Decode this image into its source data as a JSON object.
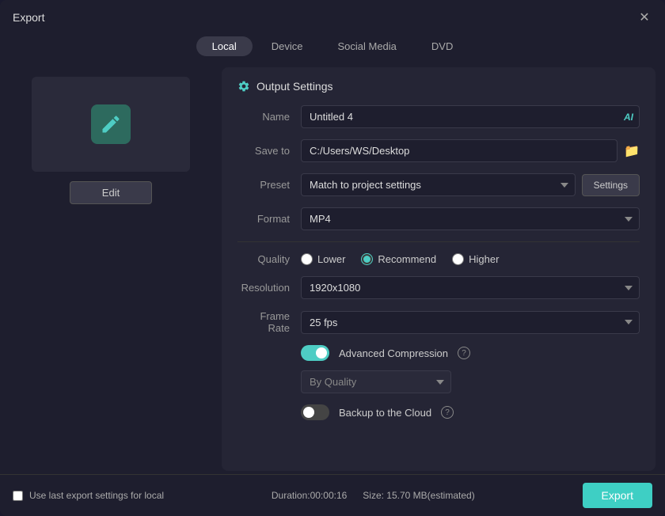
{
  "dialog": {
    "title": "Export"
  },
  "tabs": [
    {
      "id": "local",
      "label": "Local",
      "active": true
    },
    {
      "id": "device",
      "label": "Device",
      "active": false
    },
    {
      "id": "social-media",
      "label": "Social Media",
      "active": false
    },
    {
      "id": "dvd",
      "label": "DVD",
      "active": false
    }
  ],
  "preview": {
    "edit_label": "Edit"
  },
  "output_settings": {
    "header": "Output Settings",
    "name_label": "Name",
    "name_value": "Untitled 4",
    "save_to_label": "Save to",
    "save_to_value": "C:/Users/WS/Desktop",
    "preset_label": "Preset",
    "preset_value": "Match to project settings",
    "settings_label": "Settings",
    "format_label": "Format",
    "format_value": "MP4",
    "quality_label": "Quality",
    "quality_lower": "Lower",
    "quality_recommend": "Recommend",
    "quality_higher": "Higher",
    "resolution_label": "Resolution",
    "resolution_value": "1920x1080",
    "frame_rate_label": "Frame Rate",
    "frame_rate_value": "25 fps",
    "advanced_compression_label": "Advanced Compression",
    "by_quality_placeholder": "By Quality",
    "backup_cloud_label": "Backup to the Cloud"
  },
  "footer": {
    "use_last_label": "Use last export settings for local",
    "duration_label": "Duration:00:00:16",
    "size_label": "Size: 15.70 MB(estimated)",
    "export_label": "Export"
  }
}
